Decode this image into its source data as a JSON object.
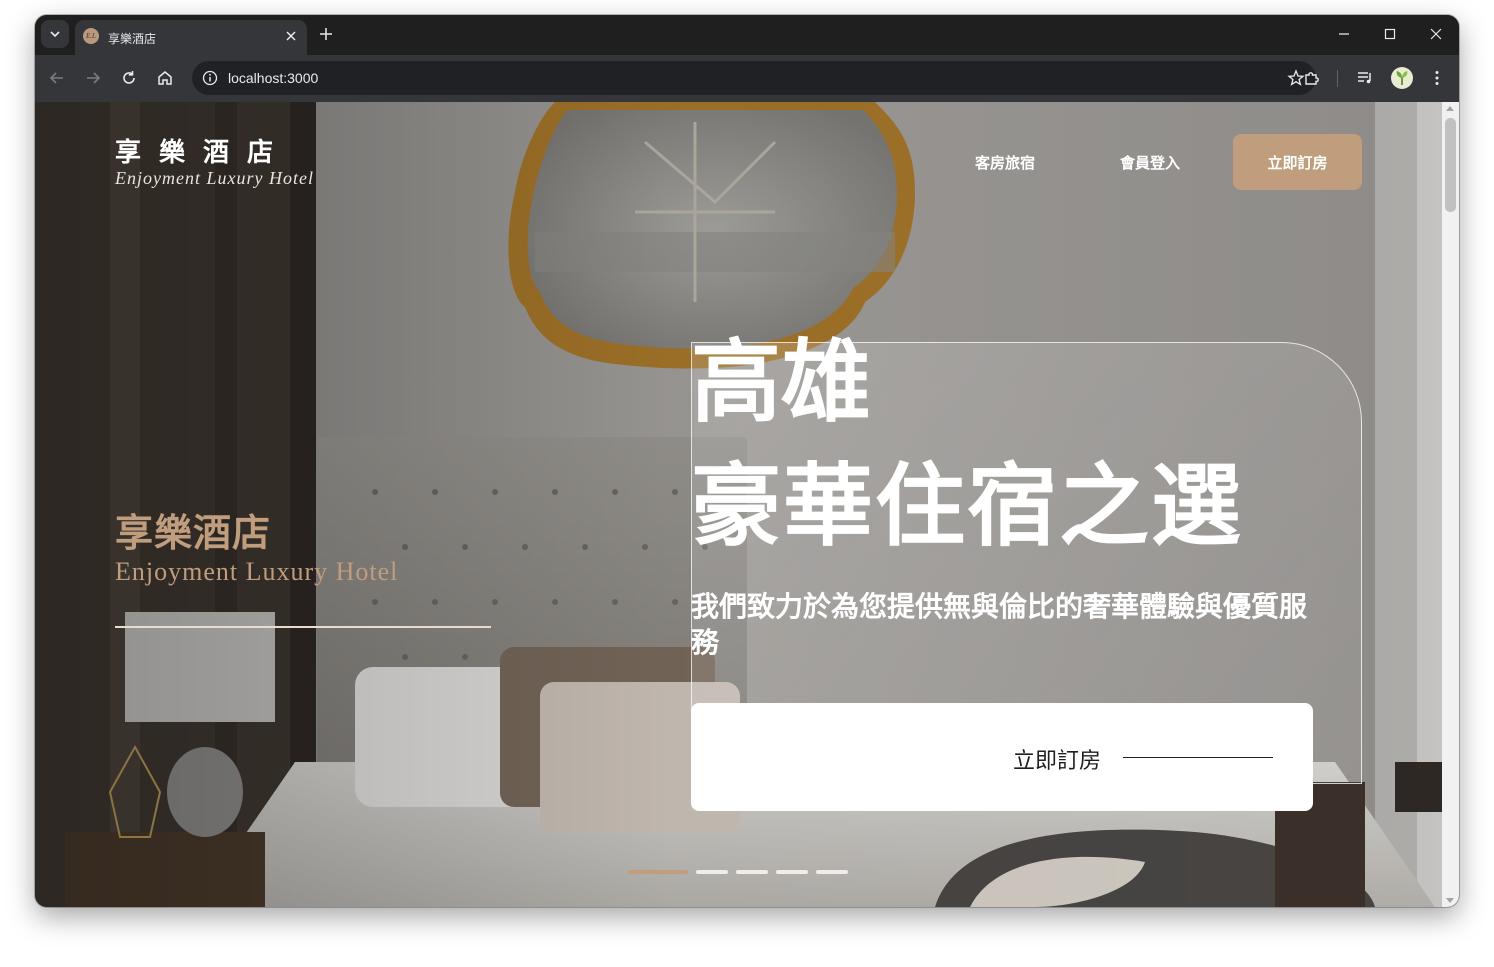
{
  "browser": {
    "tab_title": "享樂酒店",
    "tab_favicon_text": "E.L",
    "url": "localhost:3000",
    "icons": {
      "tab_menu": "chevron-down-icon",
      "close_tab": "close-icon",
      "new_tab": "plus-icon",
      "minimize": "minimize-icon",
      "maximize": "maximize-icon",
      "close_window": "close-icon",
      "back": "back-arrow-icon",
      "forward": "forward-arrow-icon",
      "reload": "reload-icon",
      "home": "home-icon",
      "site_info": "info-icon",
      "bookmark": "star-icon",
      "extensions": "puzzle-icon",
      "media": "media-queue-icon",
      "profile": "profile-avatar",
      "menu": "kebab-menu-icon"
    }
  },
  "site": {
    "header": {
      "logo_title": "享樂酒店",
      "logo_subtitle": "Enjoyment Luxury Hotel",
      "nav": {
        "rooms": "客房旅宿",
        "login": "會員登入",
        "book": "立即訂房"
      }
    },
    "hero": {
      "side_title": "享樂酒店",
      "side_subtitle": "Enjoyment Luxury Hotel",
      "heading_line1": "高雄",
      "heading_line2": "豪華住宿之選",
      "description": "我們致力於為您提供無與倫比的奢華體驗與優質服務",
      "cta_label": "立即訂房",
      "carousel": {
        "total": 5,
        "active_index": 0
      }
    }
  },
  "colors": {
    "accent": "#BF9D7D",
    "white": "#FFFFFF",
    "chrome_dark": "#1F1F1F",
    "chrome_toolbar": "#35363A"
  }
}
